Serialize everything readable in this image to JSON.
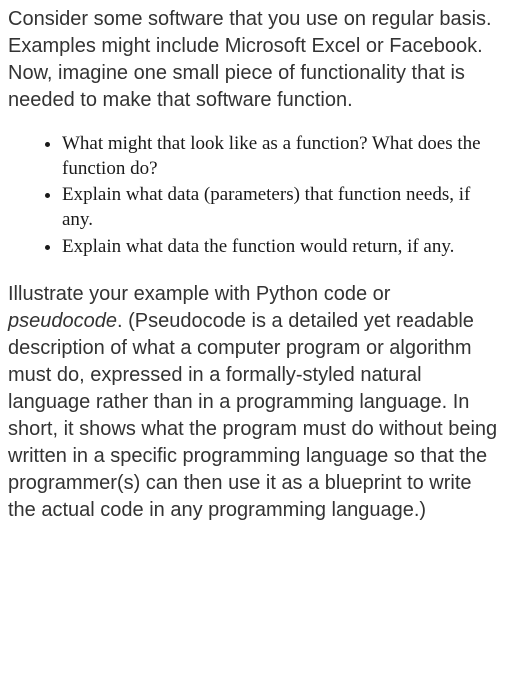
{
  "intro": "Consider some software that you use on regular basis.  Examples might include Microsoft Excel or Facebook. Now, imagine one small piece of functionality that is needed to make that software function.",
  "bullets": [
    "What might that look like as a function?  What does the function do?",
    "Explain what data (parameters) that function needs, if any.",
    "Explain what data the function would return, if any."
  ],
  "outro_before_em": "Illustrate your example with Python code or ",
  "outro_em": "pseudocode",
  "outro_after_em": ". (Pseudocode is a detailed yet readable description of what a computer program or algorithm must do, expressed in a formally-styled natural language rather than in a programming language. In short, it shows what the program must do without being written in a specific programming language so that the programmer(s) can then use it as a blueprint to write the actual code in any programming language.)"
}
